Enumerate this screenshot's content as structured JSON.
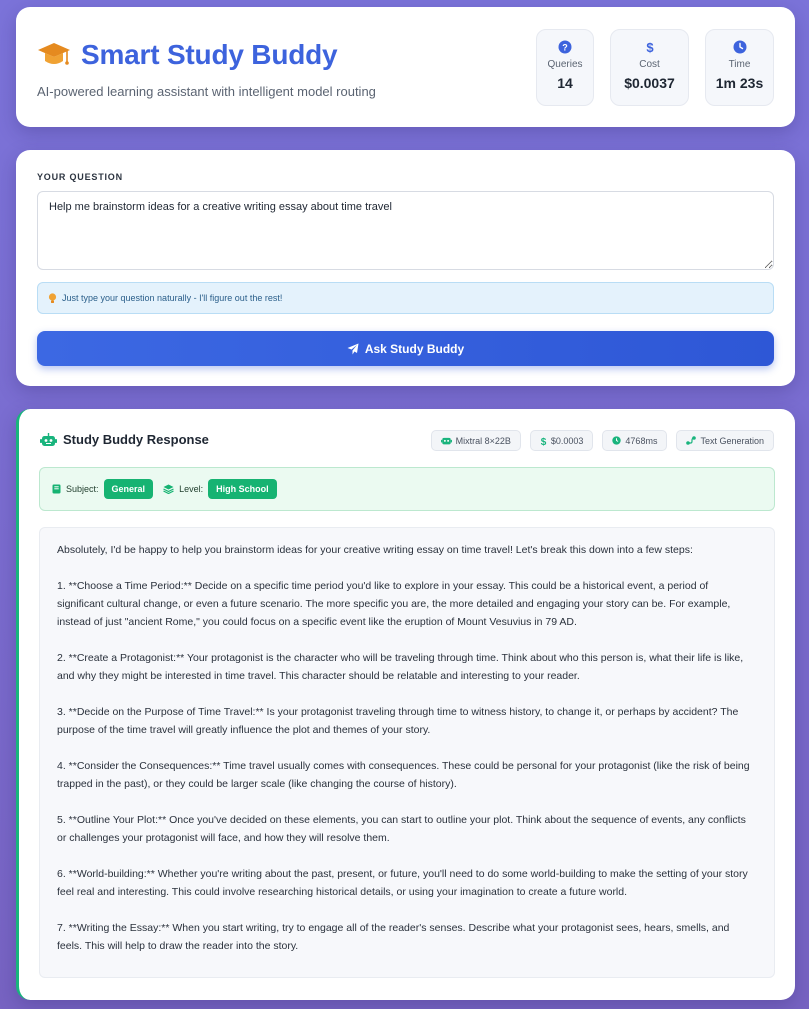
{
  "header": {
    "title": "Smart Study Buddy",
    "subtitle": "AI-powered learning assistant with intelligent model routing",
    "stats": [
      {
        "icon": "question-circle-icon",
        "label": "Queries",
        "value": "14"
      },
      {
        "icon": "dollar-icon",
        "label": "Cost",
        "value": "$0.0037"
      },
      {
        "icon": "clock-icon",
        "label": "Time",
        "value": "1m 23s"
      }
    ]
  },
  "question": {
    "label": "YOUR QUESTION",
    "value": "Help me brainstorm ideas for a creative writing essay about time travel",
    "hint": "Just type your question naturally - I'll figure out the rest!",
    "button": "Ask Study Buddy"
  },
  "response": {
    "title": "Study Buddy Response",
    "chips": {
      "model": "Mixtral 8×22B",
      "cost": "$0.0003",
      "time": "4768ms",
      "task": "Text Generation"
    },
    "subject_label": "Subject:",
    "subject": "General",
    "level_label": "Level:",
    "level": "High School",
    "paragraphs": [
      "Absolutely, I'd be happy to help you brainstorm ideas for your creative writing essay on time travel! Let's break this down into a few steps:",
      "1. **Choose a Time Period:** Decide on a specific time period you'd like to explore in your essay. This could be a historical event, a period of significant cultural change, or even a future scenario. The more specific you are, the more detailed and engaging your story can be. For example, instead of just \"ancient Rome,\" you could focus on a specific event like the eruption of Mount Vesuvius in 79 AD.",
      "2. **Create a Protagonist:** Your protagonist is the character who will be traveling through time. Think about who this person is, what their life is like, and why they might be interested in time travel. This character should be relatable and interesting to your reader.",
      "3. **Decide on the Purpose of Time Travel:** Is your protagonist traveling through time to witness history, to change it, or perhaps by accident? The purpose of the time travel will greatly influence the plot and themes of your story.",
      "4. **Consider the Consequences:** Time travel usually comes with consequences. These could be personal for your protagonist (like the risk of being trapped in the past), or they could be larger scale (like changing the course of history).",
      "5. **Outline Your Plot:** Once you've decided on these elements, you can start to outline your plot. Think about the sequence of events, any conflicts or challenges your protagonist will face, and how they will resolve them.",
      "6. **World-building:** Whether you're writing about the past, present, or future, you'll need to do some world-building to make the setting of your story feel real and interesting. This could involve researching historical details, or using your imagination to create a future world.",
      "7. **Writing the Essay:** When you start writing, try to engage all of the reader's senses. Describe what your protagonist sees, hears, smells, and feels. This will help to draw the reader into the story."
    ]
  },
  "colors": {
    "accent": "#3d63dd",
    "success": "#16b372",
    "background": "#7b73d9"
  }
}
